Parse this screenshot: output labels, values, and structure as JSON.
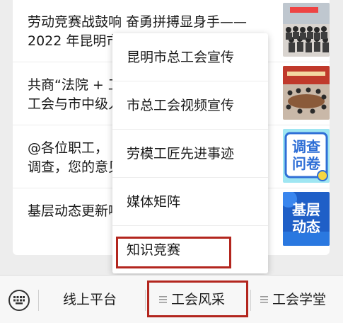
{
  "articles": [
    {
      "title": "劳动竞赛战鼓响 奋勇拼搏显身手——\n2022 年昆明市",
      "thumb_icon": "group-photo-thumbnail"
    },
    {
      "title": "共商“法院 + 工\n工会与市中级人",
      "thumb_icon": "meeting-photo-thumbnail"
    },
    {
      "title": "@各位职工，\n调查，您的意见",
      "thumb_icon": "survey-thumbnail",
      "thumb_text": [
        "调查",
        "问卷"
      ]
    },
    {
      "title": "基层动态更新啦",
      "thumb_icon": "news-thumbnail",
      "thumb_text": [
        "基层",
        "动态"
      ]
    }
  ],
  "popup_menu": {
    "items": [
      "昆明市总工会宣传",
      "市总工会视频宣传",
      "劳模工匠先进事迹",
      "媒体矩阵",
      "知识竞赛"
    ],
    "highlighted_index": 4
  },
  "bottom_menu": {
    "keyboard_icon": "keyboard-icon",
    "tabs": [
      {
        "label": "线上平台",
        "has_menu_icon": false
      },
      {
        "label": "工会风采",
        "has_menu_icon": true,
        "highlighted": true
      },
      {
        "label": "工会学堂",
        "has_menu_icon": true
      }
    ]
  },
  "colors": {
    "highlight": "#b3261e",
    "survey_blue": "#2f6fd6",
    "news_blue": "#1f5fc7",
    "survey_bg": "#9fe6f2"
  }
}
